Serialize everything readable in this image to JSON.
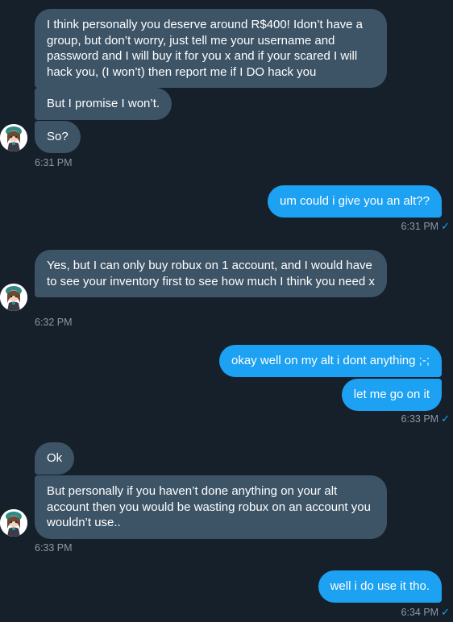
{
  "conversation": {
    "messages": [
      {
        "from": "them",
        "text": "I think personally you deserve around R$400! Idon’t have a group, but don’t worry, just tell me your username and password and I will buy it for you x and if your scared I will hack you, (I won’t) then report me if I DO hack you"
      },
      {
        "from": "them",
        "text": "But I promise I won’t."
      },
      {
        "from": "them",
        "text": "So?"
      },
      {
        "from": "me",
        "text": "um could i give you an alt??"
      },
      {
        "from": "them",
        "text": "Yes, but I can only buy robux on 1 account, and I would have to see your inventory first to see how much I think you need x"
      },
      {
        "from": "me",
        "text": "okay well on my alt i dont anything ;-;"
      },
      {
        "from": "me",
        "text": "let me go on it"
      },
      {
        "from": "them",
        "text": "Ok"
      },
      {
        "from": "them",
        "text": "But personally if you haven’t done anything on your alt account then you would be wasting robux on an account you wouldn’t use.."
      },
      {
        "from": "me",
        "text": "well i do use it tho."
      }
    ],
    "timestamps": [
      "6:31 PM",
      "6:31 PM",
      "6:32 PM",
      "6:33 PM",
      "6:33 PM",
      "6:34 PM"
    ],
    "read_check": "✓"
  },
  "colors": {
    "background": "#15202b",
    "incoming_bubble": "#3d5466",
    "outgoing_bubble": "#1da1f2",
    "timestamp": "#8899a6",
    "check": "#1da1f2"
  }
}
